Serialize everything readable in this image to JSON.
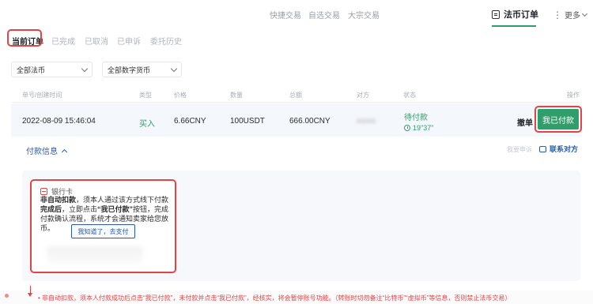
{
  "topnav": {
    "items": [
      "快捷交易",
      "自选交易",
      "大宗交易"
    ],
    "fiat_orders": "法币订单",
    "more": "更多"
  },
  "subtabs": [
    "当前订单",
    "已完成",
    "已取消",
    "已申诉",
    "委托历史"
  ],
  "filters": {
    "fiat": "全部法币",
    "crypto": "全部数字货币"
  },
  "table": {
    "headers": [
      "单号/创建时间",
      "类型",
      "价格",
      "数量",
      "总额",
      "对方",
      "状态",
      "操作"
    ],
    "row": {
      "time": "2022-08-09 15:46:04",
      "type": "买入",
      "price": "6.66CNY",
      "quantity": "100USDT",
      "total": "666.00CNY",
      "counterparty": "●●●●",
      "status": "待付款",
      "countdown": "19\"37\"",
      "cancel": "撤单",
      "paid_button": "我已付款"
    }
  },
  "payment": {
    "toggle_label": "付款信息",
    "appeal": "我要申诉",
    "contact": "联系对方",
    "bank_label": "银行卡",
    "warning_bold": "非自动扣款",
    "warning_text": "，须本人通过该方式线下付款",
    "warning_bold2": "完成后",
    "warning_text2": "，立即点击",
    "warning_bold3": "“我已付款”",
    "warning_text3": "按钮，完成付款确认流程，系统才会通知卖家给您放币。",
    "gotit_button": "我知道了，去支付"
  },
  "notice": "• 非自动扣款，须本人付款成功后点击“我已付款”，未付款并点击“我已付款”，经核实，将会暂停账号功能。（转账时切勿备注“比特币”“虚拟币”等信息，否则禁止法币交易）",
  "colors": {
    "accent_green": "#2f9e6a",
    "link_blue": "#2c5aa0",
    "highlight_red": "#e04545"
  }
}
